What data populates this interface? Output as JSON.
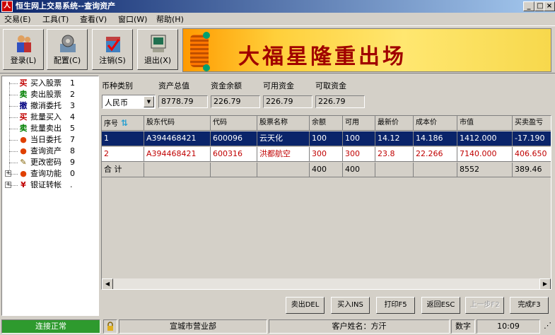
{
  "window": {
    "title": "恒生网上交易系统--查询资产",
    "app_icon": "人"
  },
  "menu": [
    "交易(E)",
    "工具(T)",
    "查看(V)",
    "窗口(W)",
    "帮助(H)"
  ],
  "toolbar": [
    {
      "label": "登录(L)",
      "icon": "login-icon"
    },
    {
      "label": "配置(C)",
      "icon": "config-icon"
    },
    {
      "label": "注销(S)",
      "icon": "logoff-icon"
    },
    {
      "label": "退出(X)",
      "icon": "exit-icon"
    }
  ],
  "banner": {
    "text": "大福星隆重出场"
  },
  "tree": [
    {
      "icon_char": "买",
      "icon_color": "#c00000",
      "label": "买入股票",
      "key": "1"
    },
    {
      "icon_char": "卖",
      "icon_color": "#008000",
      "label": "卖出股票",
      "key": "2"
    },
    {
      "icon_char": "撤",
      "icon_color": "#000080",
      "label": "撤消委托",
      "key": "3"
    },
    {
      "icon_char": "买",
      "icon_color": "#c00000",
      "label": "批量买入",
      "key": "4"
    },
    {
      "icon_char": "卖",
      "icon_color": "#008000",
      "label": "批量卖出",
      "key": "5"
    },
    {
      "icon_char": "●",
      "icon_color": "#e04000",
      "label": "当日委托",
      "key": "7"
    },
    {
      "icon_char": "●",
      "icon_color": "#e04000",
      "label": "查询资产",
      "key": "8"
    },
    {
      "icon_char": "✎",
      "icon_color": "#806000",
      "label": "更改密码",
      "key": "9"
    },
    {
      "icon_char": "●",
      "icon_color": "#e04000",
      "label": "查询功能",
      "key": "0",
      "expand": "+"
    },
    {
      "icon_char": "¥",
      "icon_color": "#c00000",
      "label": "银证转帐",
      "key": ".",
      "expand": "+"
    }
  ],
  "summary": {
    "currency_label": "币种类别",
    "currency_value": "人民币",
    "fields": [
      {
        "label": "资产总值",
        "value": "8778.79"
      },
      {
        "label": "资金余额",
        "value": "226.79"
      },
      {
        "label": "可用资金",
        "value": "226.79"
      },
      {
        "label": "可取资金",
        "value": "226.79"
      }
    ]
  },
  "grid": {
    "headers": [
      "序号",
      "股东代码",
      "代码",
      "股票名称",
      "余额",
      "可用",
      "最新价",
      "成本价",
      "市值",
      "买卖盈亏"
    ],
    "rows": [
      [
        "1",
        "A394468421",
        "600096",
        "云天化",
        "100",
        "100",
        "14.12",
        "14.186",
        "1412.000",
        "-17.190"
      ],
      [
        "2",
        "A394468421",
        "600316",
        "洪都航空",
        "300",
        "300",
        "23.8",
        "22.266",
        "7140.000",
        "406.650"
      ]
    ],
    "total": [
      "合 计",
      "",
      "",
      "",
      "400",
      "400",
      "",
      "",
      "8552",
      "389.46"
    ]
  },
  "buttons": [
    {
      "label": "卖出DEL",
      "enabled": true
    },
    {
      "label": "买入INS",
      "enabled": true
    },
    {
      "label": "打印F5",
      "enabled": true
    },
    {
      "label": "返回ESC",
      "enabled": true
    },
    {
      "label": "上一步F2",
      "enabled": false
    },
    {
      "label": "完成F3",
      "enabled": true
    }
  ],
  "status": {
    "connection": "连接正常",
    "branch": "宣城市营业部",
    "customer": "客户姓名：方汗",
    "mode": "数字",
    "time": "10:09"
  },
  "colors": {
    "connection_ok": "#2e9a2e",
    "selected_row": "#0a246a",
    "loss_text": "#c00000"
  }
}
